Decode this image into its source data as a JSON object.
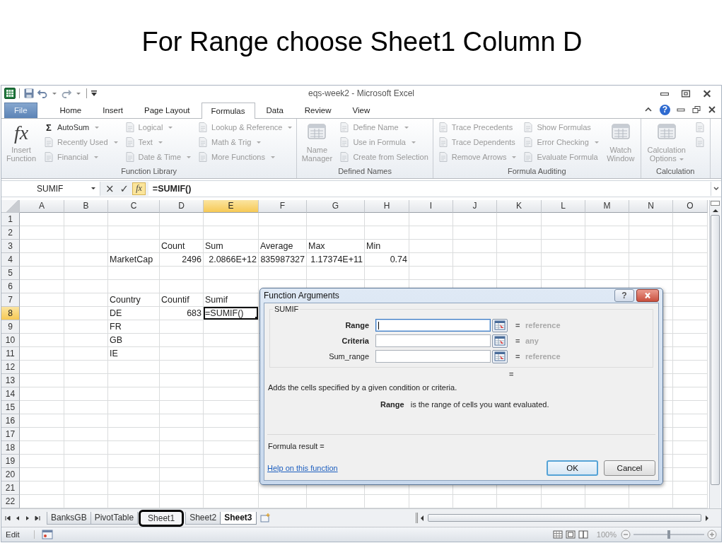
{
  "slide": {
    "title": "For Range choose Sheet1 Column D"
  },
  "window": {
    "title": "eqs-week2  -  Microsoft Excel",
    "help_glyph": "?"
  },
  "tabs": [
    {
      "label": "File",
      "kind": "file",
      "selected": false
    },
    {
      "label": "Home",
      "kind": "tab",
      "selected": false
    },
    {
      "label": "Insert",
      "kind": "tab",
      "selected": false
    },
    {
      "label": "Page Layout",
      "kind": "tab",
      "selected": false
    },
    {
      "label": "Formulas",
      "kind": "tab",
      "selected": true
    },
    {
      "label": "Data",
      "kind": "tab",
      "selected": false
    },
    {
      "label": "Review",
      "kind": "tab",
      "selected": false
    },
    {
      "label": "View",
      "kind": "tab",
      "selected": false
    }
  ],
  "ribbon": [
    {
      "label": "Function Library",
      "blocks": [
        {
          "kind": "large",
          "label": "Insert Function",
          "glyph": "fx",
          "dropdown": false,
          "disabled": true
        },
        {
          "kind": "column",
          "items": [
            {
              "label": "AutoSum",
              "glyph": "Σ",
              "dropdown": true,
              "disabled": false
            },
            {
              "label": "Recently Used",
              "dropdown": true,
              "disabled": true
            },
            {
              "label": "Financial",
              "dropdown": true,
              "disabled": true
            }
          ]
        },
        {
          "kind": "column",
          "items": [
            {
              "label": "Logical",
              "dropdown": true,
              "disabled": true
            },
            {
              "label": "Text",
              "dropdown": true,
              "disabled": true
            },
            {
              "label": "Date & Time",
              "dropdown": true,
              "disabled": true
            }
          ]
        },
        {
          "kind": "column",
          "items": [
            {
              "label": "Lookup & Reference",
              "dropdown": true,
              "disabled": true
            },
            {
              "label": "Math & Trig",
              "dropdown": true,
              "disabled": true
            },
            {
              "label": "More Functions",
              "dropdown": true,
              "disabled": true
            }
          ]
        }
      ]
    },
    {
      "label": "Defined Names",
      "blocks": [
        {
          "kind": "large",
          "label": "Name Manager",
          "dropdown": false,
          "disabled": true
        },
        {
          "kind": "column",
          "items": [
            {
              "label": "Define Name",
              "dropdown": true,
              "disabled": true
            },
            {
              "label": "Use in Formula",
              "dropdown": true,
              "disabled": true
            },
            {
              "label": "Create from Selection",
              "dropdown": false,
              "disabled": true
            }
          ]
        }
      ]
    },
    {
      "label": "Formula Auditing",
      "blocks": [
        {
          "kind": "column",
          "items": [
            {
              "label": "Trace Precedents",
              "dropdown": false,
              "disabled": true
            },
            {
              "label": "Trace Dependents",
              "dropdown": false,
              "disabled": true
            },
            {
              "label": "Remove Arrows",
              "dropdown": true,
              "disabled": true
            }
          ]
        },
        {
          "kind": "column",
          "items": [
            {
              "label": "Show Formulas",
              "dropdown": false,
              "disabled": true
            },
            {
              "label": "Error Checking",
              "dropdown": true,
              "disabled": true
            },
            {
              "label": "Evaluate Formula",
              "dropdown": false,
              "disabled": true
            }
          ]
        },
        {
          "kind": "large",
          "label": "Watch Window",
          "dropdown": false,
          "disabled": true
        }
      ]
    },
    {
      "label": "Calculation",
      "blocks": [
        {
          "kind": "large",
          "label": "Calculation Options",
          "dropdown": true,
          "disabled": true
        },
        {
          "kind": "column",
          "items": [
            {
              "dropdown": false,
              "disabled": true
            },
            {
              "dropdown": false,
              "disabled": true
            }
          ]
        }
      ]
    }
  ],
  "formula_bar": {
    "name_box": "SUMIF",
    "cancel": "×",
    "enter": "✓",
    "fx": "fx",
    "formula": "=SUMIF()"
  },
  "sheet": {
    "columns": [
      {
        "label": "A",
        "selected": false
      },
      {
        "label": "B",
        "selected": false
      },
      {
        "label": "C",
        "selected": false
      },
      {
        "label": "D",
        "selected": false
      },
      {
        "label": "E",
        "selected": true
      },
      {
        "label": "F",
        "selected": false
      },
      {
        "label": "G",
        "selected": false
      },
      {
        "label": "H",
        "selected": false
      },
      {
        "label": "I",
        "selected": false
      },
      {
        "label": "J",
        "selected": false
      },
      {
        "label": "K",
        "selected": false
      },
      {
        "label": "L",
        "selected": false
      },
      {
        "label": "M",
        "selected": false
      },
      {
        "label": "N",
        "selected": false
      },
      {
        "label": "O",
        "selected": false
      }
    ],
    "rows": [
      {
        "header": "1",
        "selected": false
      },
      {
        "header": "2",
        "selected": false
      },
      {
        "header": "3",
        "selected": false,
        "cells": [
          null,
          null,
          null,
          {
            "text": "Count",
            "kind": "text",
            "selected": false
          },
          {
            "text": "Sum",
            "kind": "text",
            "selected": false
          },
          {
            "text": "Average",
            "kind": "text",
            "selected": false
          },
          {
            "text": "Max",
            "kind": "text",
            "selected": false
          },
          {
            "text": "Min",
            "kind": "text",
            "selected": false
          }
        ]
      },
      {
        "header": "4",
        "selected": false,
        "cells": [
          null,
          null,
          {
            "text": "MarketCap",
            "kind": "text",
            "selected": false
          },
          {
            "text": "2496",
            "kind": "number",
            "selected": false
          },
          {
            "text": "2.0866E+12",
            "kind": "number",
            "selected": false
          },
          {
            "text": "835987327",
            "kind": "number",
            "selected": false
          },
          {
            "text": "1.17374E+11",
            "kind": "number",
            "selected": false
          },
          {
            "text": "0.74",
            "kind": "number",
            "selected": false
          }
        ]
      },
      {
        "header": "5",
        "selected": false
      },
      {
        "header": "6",
        "selected": false
      },
      {
        "header": "7",
        "selected": false,
        "cells": [
          null,
          null,
          {
            "text": "Country",
            "kind": "text",
            "selected": false
          },
          {
            "text": "Countif",
            "kind": "text",
            "selected": false
          },
          {
            "text": "Sumif",
            "kind": "text",
            "selected": false
          }
        ]
      },
      {
        "header": "8",
        "selected": true,
        "cells": [
          null,
          null,
          {
            "text": "DE",
            "kind": "text",
            "selected": false
          },
          {
            "text": "683",
            "kind": "number",
            "selected": false
          },
          {
            "text": "=SUMIF()",
            "kind": "text",
            "selected": true
          }
        ]
      },
      {
        "header": "9",
        "selected": false,
        "cells": [
          null,
          null,
          {
            "text": "FR",
            "kind": "text",
            "selected": false
          }
        ]
      },
      {
        "header": "10",
        "selected": false,
        "cells": [
          null,
          null,
          {
            "text": "GB",
            "kind": "text",
            "selected": false
          }
        ]
      },
      {
        "header": "11",
        "selected": false,
        "cells": [
          null,
          null,
          {
            "text": "IE",
            "kind": "text",
            "selected": false
          }
        ]
      },
      {
        "header": "12",
        "selected": false
      },
      {
        "header": "13",
        "selected": false
      },
      {
        "header": "14",
        "selected": false
      },
      {
        "header": "15",
        "selected": false
      },
      {
        "header": "16",
        "selected": false
      },
      {
        "header": "17",
        "selected": false
      },
      {
        "header": "18",
        "selected": false
      },
      {
        "header": "19",
        "selected": false
      },
      {
        "header": "20",
        "selected": false
      },
      {
        "header": "21",
        "selected": false
      },
      {
        "header": "22",
        "selected": false
      }
    ]
  },
  "sheet_tabs": [
    {
      "label": "BanksGB",
      "selected": false,
      "highlighted": false
    },
    {
      "label": "PivotTable",
      "selected": false,
      "highlighted": false
    },
    {
      "label": "Sheet1",
      "selected": false,
      "highlighted": true
    },
    {
      "label": "Sheet2",
      "selected": false,
      "highlighted": false
    },
    {
      "label": "Sheet3",
      "selected": true,
      "highlighted": false
    }
  ],
  "status_bar": {
    "mode": "Edit",
    "zoom": "100%",
    "zoom_slider": {
      "level": 0.5
    }
  },
  "dialog": {
    "title": "Function Arguments",
    "help_glyph": "?",
    "function": "SUMIF",
    "arguments": [
      {
        "label": "Range",
        "required": true,
        "focused": true,
        "equals": "=",
        "hint": "reference"
      },
      {
        "label": "Criteria",
        "required": true,
        "focused": false,
        "equals": "=",
        "hint": "any"
      },
      {
        "label": "Sum_range",
        "required": false,
        "focused": false,
        "equals": "=",
        "hint": "reference"
      }
    ],
    "result_equals": "=",
    "description": "Adds the cells specified by a given condition or criteria.",
    "argument_help": "**Range**   is the range of cells you want evaluated.",
    "formula_result": "Formula result =",
    "help_link": "Help on this function",
    "buttons": [
      {
        "label": "OK",
        "default": true
      },
      {
        "label": "Cancel",
        "default": false
      }
    ]
  }
}
